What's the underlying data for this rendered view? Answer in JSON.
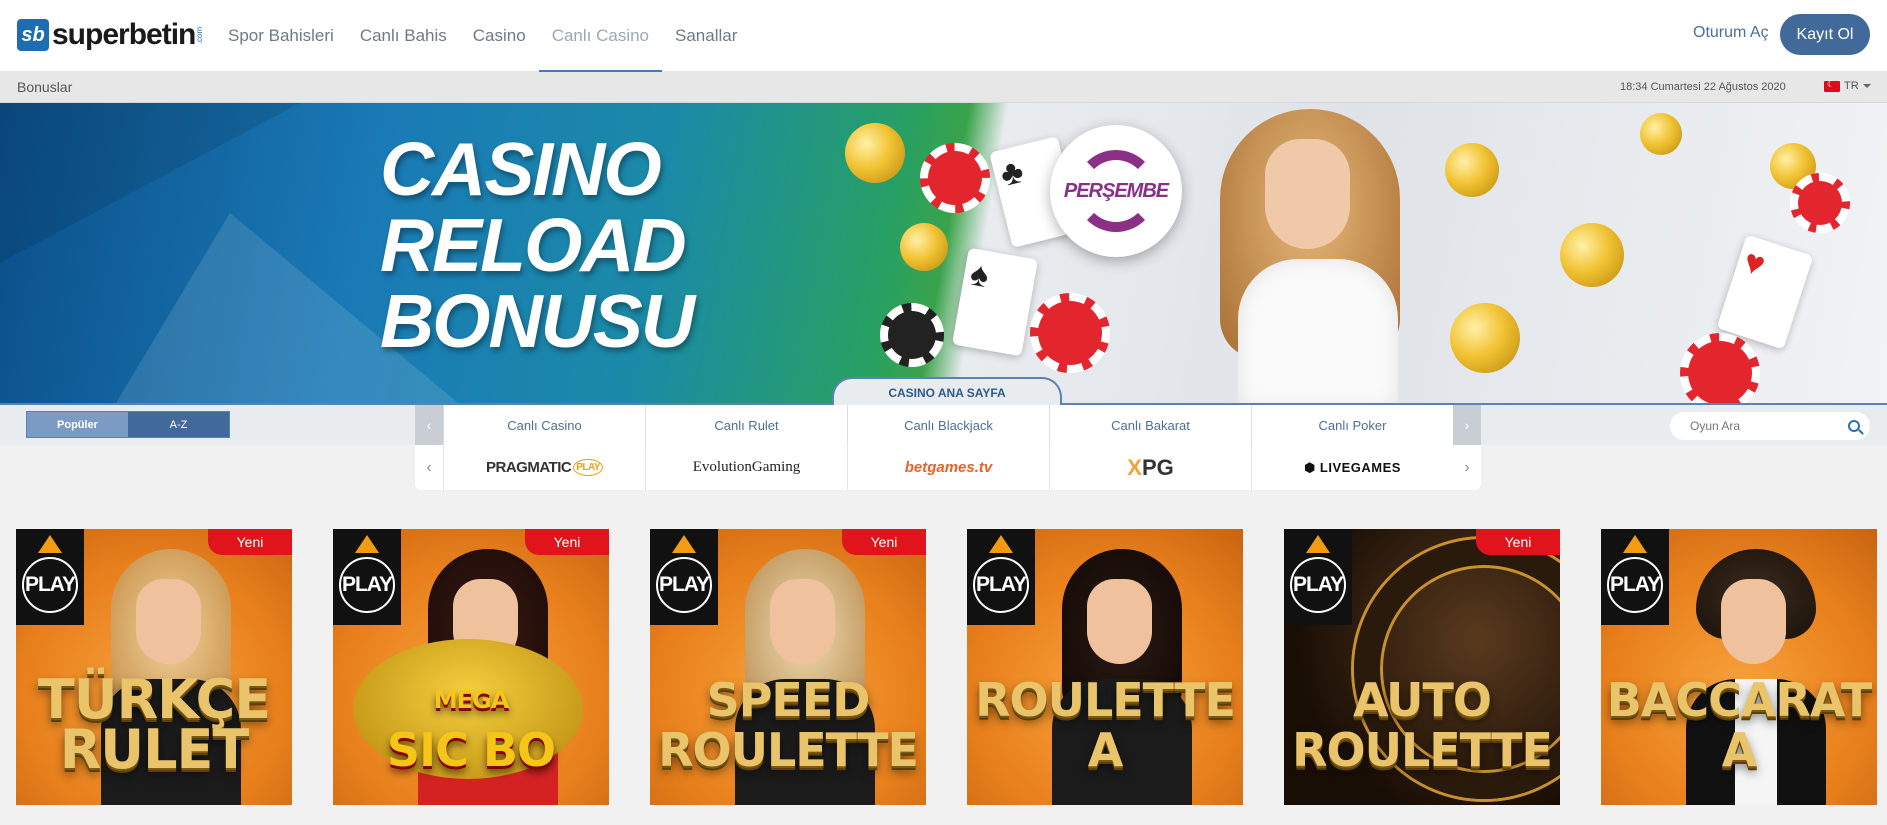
{
  "header": {
    "logo_text": "superbetin",
    "logo_badge": "sb",
    "logo_suffix": ".com",
    "nav": [
      "Spor Bahisleri",
      "Canlı Bahis",
      "Casino",
      "Canlı Casino",
      "Sanallar"
    ],
    "active_nav": "Canlı Casino",
    "login_label": "Oturum Aç",
    "register_label": "Kayıt Ol"
  },
  "subbar": {
    "bonus_label": "Bonuslar",
    "datetime": "18:34 Cumartesi 22 Ağustos 2020",
    "language": "TR"
  },
  "banner": {
    "headline_1": "CASINO",
    "headline_2": "RELOAD",
    "headline_3": "BONUSU",
    "badge_text": "PERŞEMBE",
    "home_tab": "CASINO ANA SAYFA"
  },
  "filters": {
    "sort_popular": "Popüler",
    "sort_az": "A-Z",
    "categories": [
      "Canlı Casino",
      "Canlı Rulet",
      "Canlı Blackjack",
      "Canlı Bakarat",
      "Canlı Poker"
    ],
    "search_placeholder": "Oyun Ara"
  },
  "providers": {
    "p1": "PRAGMATIC",
    "p1_badge": "PLAY",
    "p2": "EvolutionGaming",
    "p3": "betgames.tv",
    "p4_x": "X",
    "p4": "PG",
    "p5": "LIVEGAMES"
  },
  "games": [
    {
      "title_1": "TÜRKÇE",
      "title_2": "RULET",
      "badge": "Yeni",
      "logo": "PLAY"
    },
    {
      "title_1": "MEGA",
      "title_2": "SIC BO",
      "badge": "Yeni",
      "logo": "PLAY"
    },
    {
      "title_1": "SPEED",
      "title_2": "ROULETTE",
      "badge": "Yeni",
      "logo": "PLAY"
    },
    {
      "title_1": "",
      "title_2": "ROULETTE A",
      "badge": "",
      "logo": "PLAY"
    },
    {
      "title_1": "AUTO",
      "title_2": "ROULETTE",
      "badge": "Yeni",
      "logo": "PLAY"
    },
    {
      "title_1": "",
      "title_2": "BACCARAT A",
      "badge": "",
      "logo": "PLAY"
    }
  ],
  "colors": {
    "brand_blue": "#41699a",
    "accent_red": "#e0141a",
    "tile_orange": "#e8801c"
  }
}
